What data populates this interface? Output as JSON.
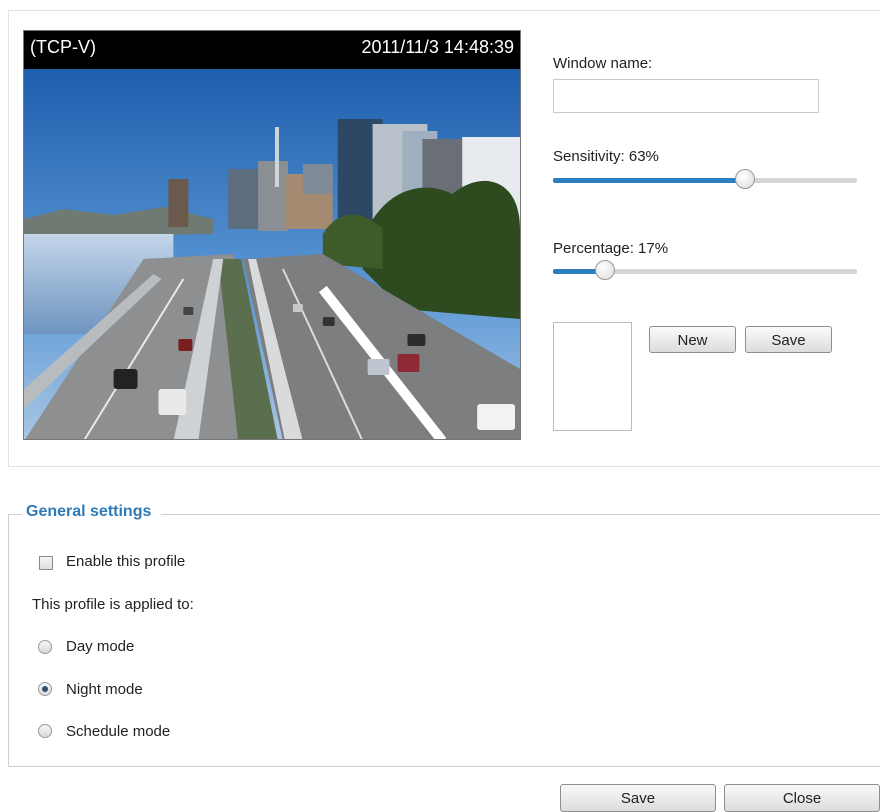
{
  "video": {
    "stream_label": "(TCP-V)",
    "timestamp": "2011/11/3 14:48:39"
  },
  "window_name": {
    "label": "Window name:",
    "value": "",
    "placeholder": ""
  },
  "sensitivity": {
    "label": "Sensitivity: 63%",
    "value_percent": 63
  },
  "percentage": {
    "label": "Percentage: 17%",
    "value_percent": 17
  },
  "window_buttons": {
    "new_label": "New",
    "save_label": "Save"
  },
  "general_settings": {
    "title": "General settings",
    "enable_label": "Enable this profile",
    "enable_checked": false,
    "applied_to_label": "This profile is applied to:",
    "modes": [
      {
        "label": "Day mode",
        "selected": false
      },
      {
        "label": "Night mode",
        "selected": true
      },
      {
        "label": "Schedule mode",
        "selected": false
      }
    ]
  },
  "footer": {
    "save_label": "Save",
    "close_label": "Close"
  },
  "colors": {
    "accent": "#2f7ab8",
    "slider_fill": "#2a7fc0"
  },
  "icons": {
    "checkbox": "checkbox-icon",
    "radio": "radio-icon"
  }
}
